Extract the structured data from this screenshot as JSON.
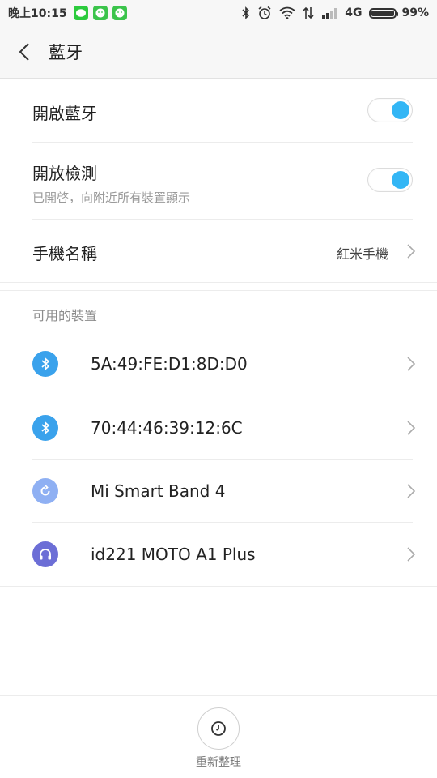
{
  "status_bar": {
    "time": "晚上10:15",
    "network": "4G",
    "battery": "99%",
    "battery_level": 0.99
  },
  "header": {
    "title": "藍牙"
  },
  "settings": {
    "bluetooth": {
      "label": "開啟藍牙",
      "enabled": true
    },
    "discoverable": {
      "label": "開放檢測",
      "sublabel": "已開啓，向附近所有裝置顯示",
      "enabled": true
    },
    "device_name": {
      "label": "手機名稱",
      "value": "紅米手機"
    }
  },
  "available": {
    "section_label": "可用的裝置",
    "devices": [
      {
        "name": "5A:49:FE:D1:8D:D0",
        "icon": "bluetooth-icon"
      },
      {
        "name": "70:44:46:39:12:6C",
        "icon": "bluetooth-icon"
      },
      {
        "name": "Mi Smart Band 4",
        "icon": "band-icon"
      },
      {
        "name": "id221 MOTO A1 Plus",
        "icon": "headphones-icon"
      }
    ]
  },
  "bottom": {
    "refresh_label": "重新整理"
  },
  "colors": {
    "accent": "#33b6f5",
    "bluetooth_icon_bg": "#3aa2ec",
    "band_icon_bg": "#8fb0f3",
    "headphone_icon_bg": "#6c6ed6"
  }
}
